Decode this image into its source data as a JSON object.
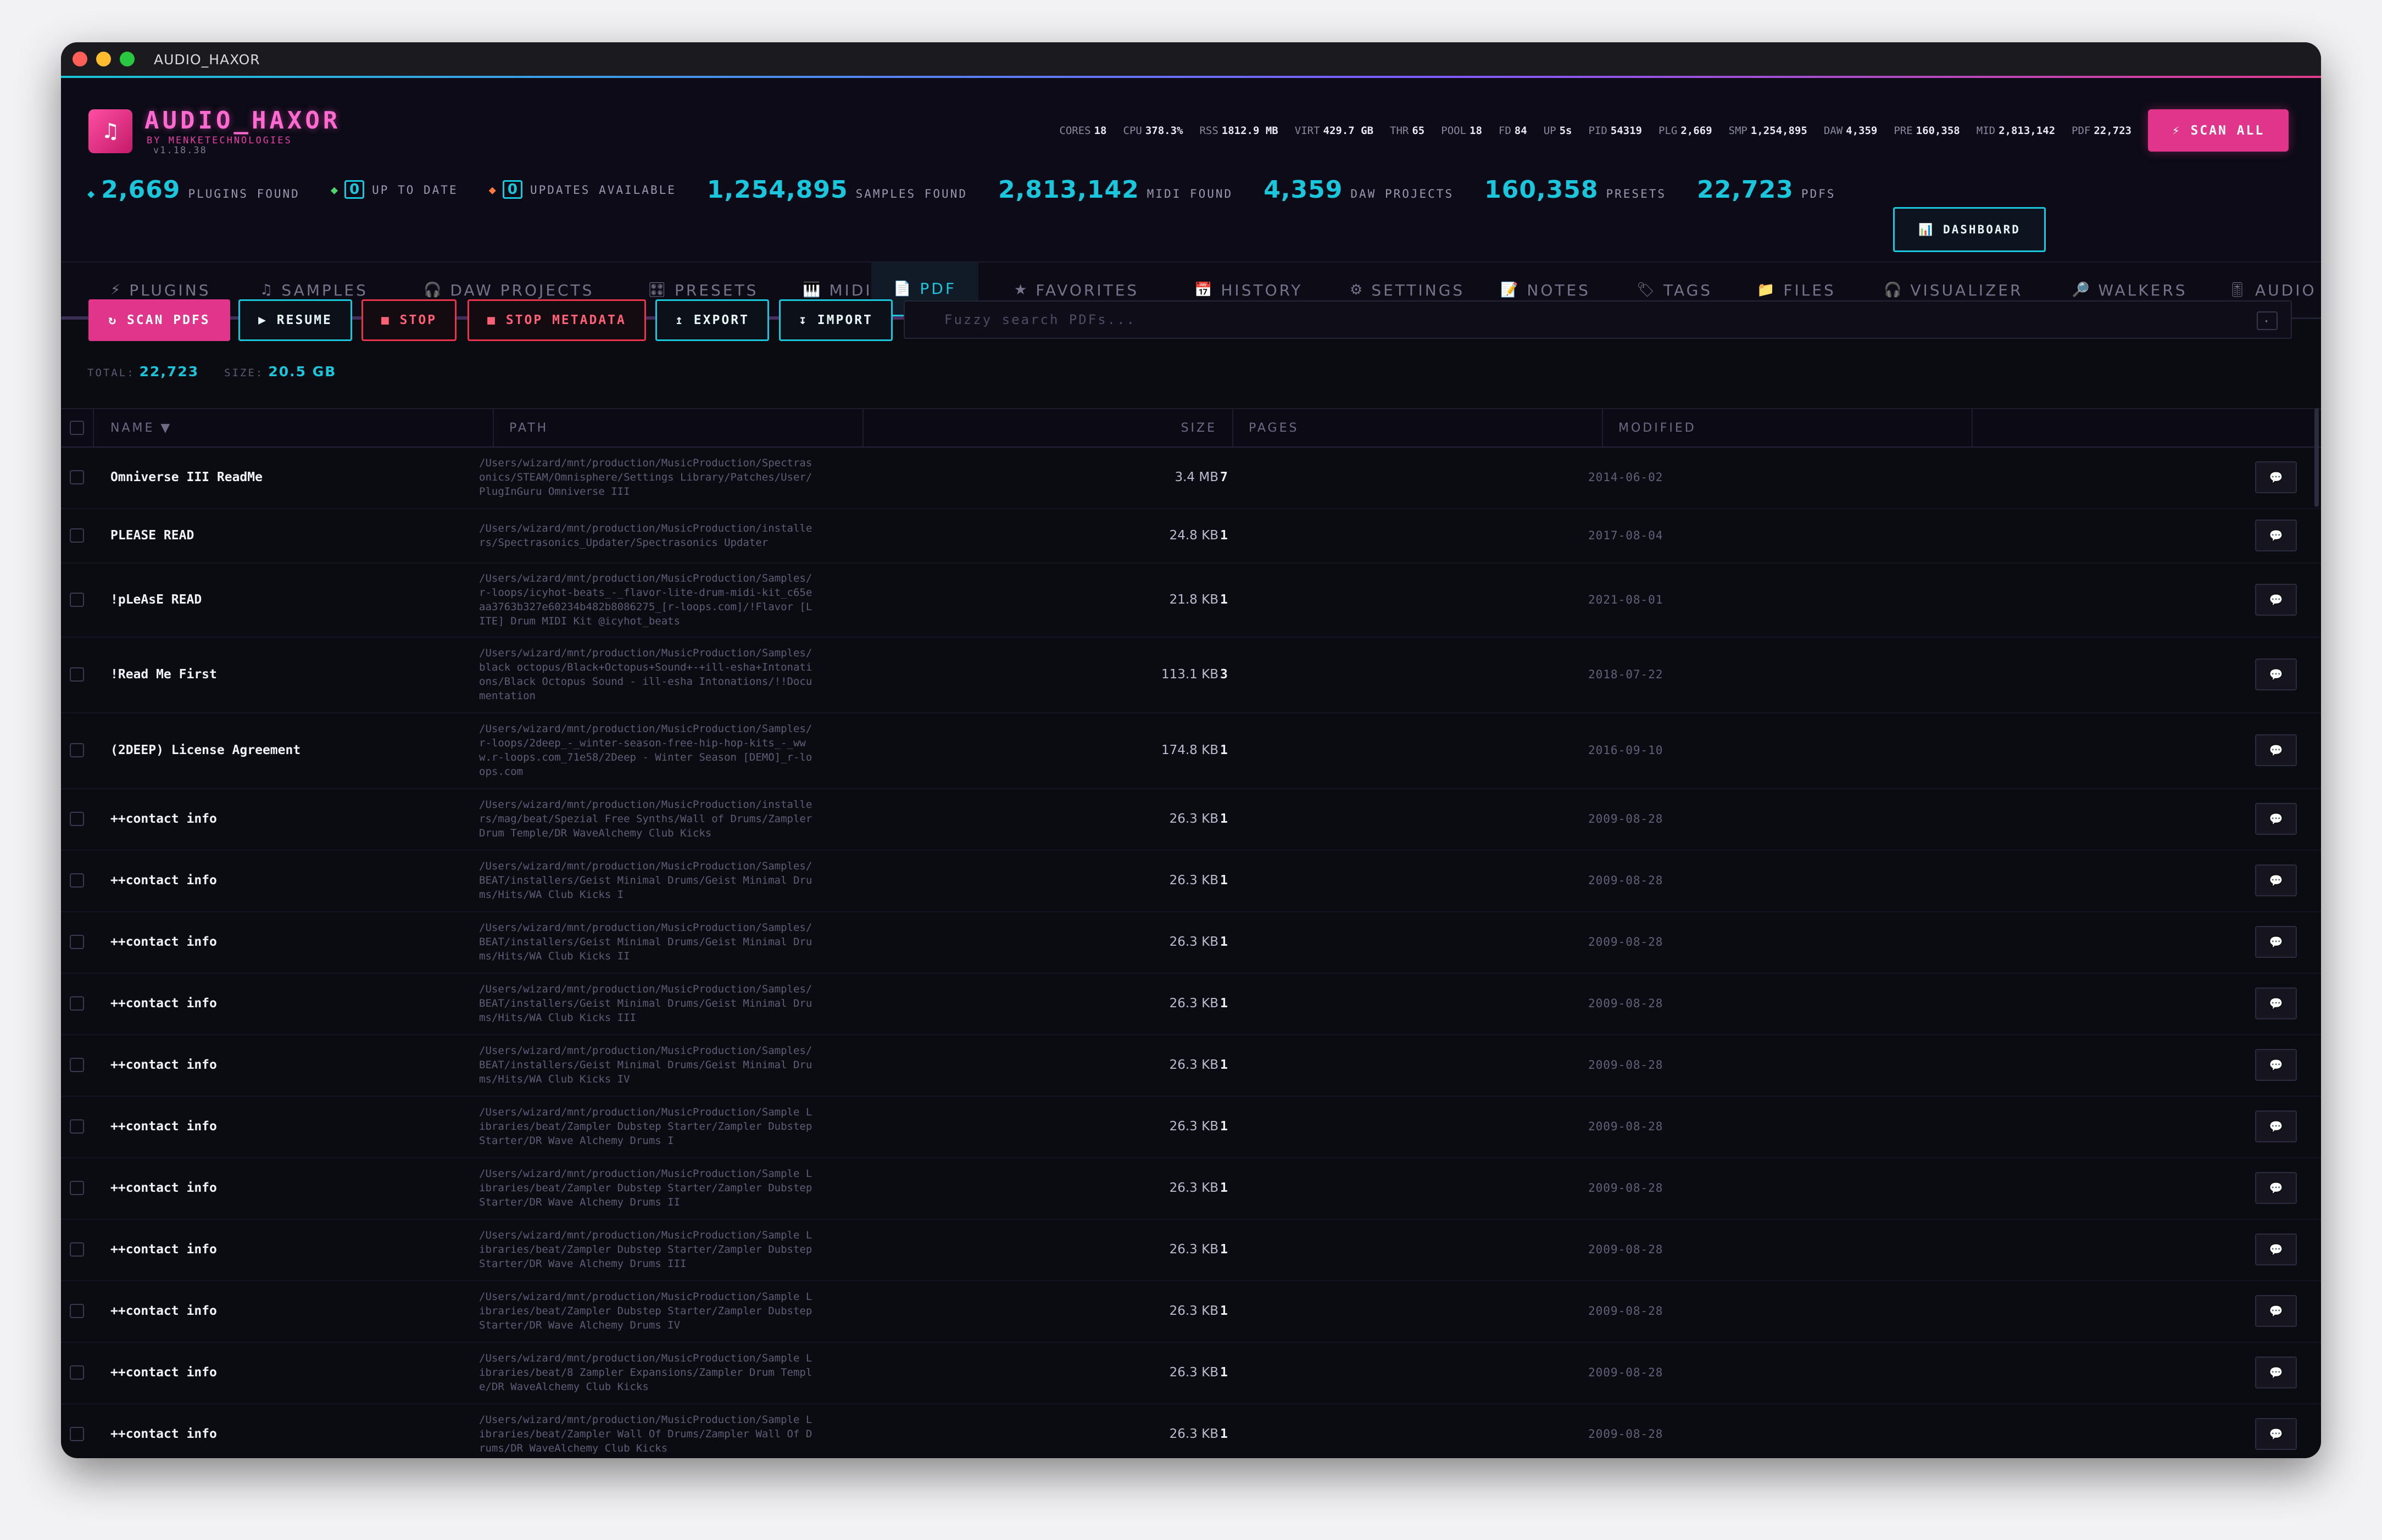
{
  "window": {
    "title": "AUDIO_HAXOR"
  },
  "app": {
    "name": "AUDIO_HAXOR",
    "by": "BY MENKETECHNOLOGIES",
    "version": "v1.18.38",
    "logo_icon": "♫"
  },
  "sys": [
    {
      "k": "CORES",
      "v": "18"
    },
    {
      "k": "CPU",
      "v": "378.3%"
    },
    {
      "k": "RSS",
      "v": "1812.9 MB"
    },
    {
      "k": "VIRT",
      "v": "429.7 GB"
    },
    {
      "k": "THR",
      "v": "65"
    },
    {
      "k": "POOL",
      "v": "18"
    },
    {
      "k": "FD",
      "v": "84"
    },
    {
      "k": "UP",
      "v": "5s"
    },
    {
      "k": "PID",
      "v": "54319"
    },
    {
      "k": "PLG",
      "v": "2,669"
    },
    {
      "k": "SMP",
      "v": "1,254,895"
    },
    {
      "k": "DAW",
      "v": "4,359"
    },
    {
      "k": "PRE",
      "v": "160,358"
    },
    {
      "k": "MID",
      "v": "2,813,142"
    },
    {
      "k": "PDF",
      "v": "22,723"
    }
  ],
  "scan_all": "⚡ SCAN ALL",
  "counters": {
    "plugins": {
      "num": "2,669",
      "label": "PLUGINS FOUND"
    },
    "uptodate": {
      "num": "0",
      "label": "UP TO DATE"
    },
    "updates": {
      "num": "0",
      "label": "UPDATES AVAILABLE"
    },
    "samples": {
      "num": "1,254,895",
      "label": "SAMPLES FOUND"
    },
    "midi": {
      "num": "2,813,142",
      "label": "MIDI FOUND"
    },
    "daw": {
      "num": "4,359",
      "label": "DAW PROJECTS"
    },
    "presets": {
      "num": "160,358",
      "label": "PRESETS"
    },
    "pdfs": {
      "num": "22,723",
      "label": "PDFS"
    }
  },
  "dashboard": "📊 DASHBOARD",
  "tabs": [
    {
      "icon": "⚡",
      "label": "PLUGINS"
    },
    {
      "icon": "♫",
      "label": "SAMPLES"
    },
    {
      "icon": "🎧",
      "label": "DAW PROJECTS"
    },
    {
      "icon": "🎛",
      "label": "PRESETS"
    },
    {
      "icon": "🎹",
      "label": "MIDI"
    },
    {
      "icon": "📄",
      "label": "PDF"
    },
    {
      "icon": "★",
      "label": "FAVORITES"
    },
    {
      "icon": "📅",
      "label": "HISTORY"
    },
    {
      "icon": "⚙",
      "label": "SETTINGS"
    },
    {
      "icon": "📝",
      "label": "NOTES"
    },
    {
      "icon": "🏷",
      "label": "TAGS"
    },
    {
      "icon": "📁",
      "label": "FILES"
    },
    {
      "icon": "🎧",
      "label": "VISUALIZER"
    },
    {
      "icon": "🔎",
      "label": "WALKERS"
    },
    {
      "icon": "🎚",
      "label": "AUDIO"
    }
  ],
  "toolbar": {
    "scan": "↻ SCAN PDFS",
    "resume": "▶ RESUME",
    "stop": "■ STOP",
    "stop_meta": "■ STOP METADATA",
    "export": "↥ EXPORT",
    "import": "↧ IMPORT",
    "search_placeholder": "Fuzzy search PDFs..."
  },
  "totals": {
    "total_label": "TOTAL:",
    "total": "22,723",
    "size_label": "SIZE:",
    "size": "20.5 GB"
  },
  "columns": {
    "name": "NAME ▼",
    "path": "PATH",
    "size": "SIZE",
    "pages": "PAGES",
    "modified": "MODIFIED"
  },
  "rows": [
    {
      "name": "Omniverse III ReadMe",
      "path": "/Users/wizard/mnt/production/MusicProduction/Spectrasonics/STEAM/Omnisphere/Settings Library/Patches/User/PlugInGuru Omniverse III",
      "size": "3.4 MB",
      "pages": "7",
      "modified": "2014-06-02"
    },
    {
      "name": "PLEASE READ",
      "path": "/Users/wizard/mnt/production/MusicProduction/installers/Spectrasonics_Updater/Spectrasonics Updater",
      "size": "24.8 KB",
      "pages": "1",
      "modified": "2017-08-04"
    },
    {
      "name": "!pLeAsE READ",
      "path": "/Users/wizard/mnt/production/MusicProduction/Samples/r-loops/icyhot-beats_-_flavor-lite-drum-midi-kit_c65eaa3763b327e60234b482b8086275_[r-loops.com]/!Flavor [LITE] Drum MIDI Kit @icyhot_beats",
      "size": "21.8 KB",
      "pages": "1",
      "modified": "2021-08-01"
    },
    {
      "name": "!Read Me First",
      "path": "/Users/wizard/mnt/production/MusicProduction/Samples/black octopus/Black+Octopus+Sound+-+ill-esha+Intonations/Black Octopus Sound - ill-esha Intonations/!!Documentation",
      "size": "113.1 KB",
      "pages": "3",
      "modified": "2018-07-22"
    },
    {
      "name": "(2DEEP) License Agreement",
      "path": "/Users/wizard/mnt/production/MusicProduction/Samples/r-loops/2deep_-_winter-season-free-hip-hop-kits_-_www.r-loops.com_71e58/2Deep - Winter Season [DEMO]_r-loops.com",
      "size": "174.8 KB",
      "pages": "1",
      "modified": "2016-09-10"
    },
    {
      "name": "++contact info",
      "path": "/Users/wizard/mnt/production/MusicProduction/installers/mag/beat/Spezial Free Synths/Wall of Drums/Zampler Drum Temple/DR WaveAlchemy Club Kicks",
      "size": "26.3 KB",
      "pages": "1",
      "modified": "2009-08-28"
    },
    {
      "name": "++contact info",
      "path": "/Users/wizard/mnt/production/MusicProduction/Samples/BEAT/installers/Geist Minimal Drums/Geist Minimal Drums/Hits/WA Club Kicks I",
      "size": "26.3 KB",
      "pages": "1",
      "modified": "2009-08-28"
    },
    {
      "name": "++contact info",
      "path": "/Users/wizard/mnt/production/MusicProduction/Samples/BEAT/installers/Geist Minimal Drums/Geist Minimal Drums/Hits/WA Club Kicks II",
      "size": "26.3 KB",
      "pages": "1",
      "modified": "2009-08-28"
    },
    {
      "name": "++contact info",
      "path": "/Users/wizard/mnt/production/MusicProduction/Samples/BEAT/installers/Geist Minimal Drums/Geist Minimal Drums/Hits/WA Club Kicks III",
      "size": "26.3 KB",
      "pages": "1",
      "modified": "2009-08-28"
    },
    {
      "name": "++contact info",
      "path": "/Users/wizard/mnt/production/MusicProduction/Samples/BEAT/installers/Geist Minimal Drums/Geist Minimal Drums/Hits/WA Club Kicks IV",
      "size": "26.3 KB",
      "pages": "1",
      "modified": "2009-08-28"
    },
    {
      "name": "++contact info",
      "path": "/Users/wizard/mnt/production/MusicProduction/Sample Libraries/beat/Zampler Dubstep Starter/Zampler Dubstep Starter/DR Wave Alchemy Drums I",
      "size": "26.3 KB",
      "pages": "1",
      "modified": "2009-08-28"
    },
    {
      "name": "++contact info",
      "path": "/Users/wizard/mnt/production/MusicProduction/Sample Libraries/beat/Zampler Dubstep Starter/Zampler Dubstep Starter/DR Wave Alchemy Drums II",
      "size": "26.3 KB",
      "pages": "1",
      "modified": "2009-08-28"
    },
    {
      "name": "++contact info",
      "path": "/Users/wizard/mnt/production/MusicProduction/Sample Libraries/beat/Zampler Dubstep Starter/Zampler Dubstep Starter/DR Wave Alchemy Drums III",
      "size": "26.3 KB",
      "pages": "1",
      "modified": "2009-08-28"
    },
    {
      "name": "++contact info",
      "path": "/Users/wizard/mnt/production/MusicProduction/Sample Libraries/beat/Zampler Dubstep Starter/Zampler Dubstep Starter/DR Wave Alchemy Drums IV",
      "size": "26.3 KB",
      "pages": "1",
      "modified": "2009-08-28"
    },
    {
      "name": "++contact info",
      "path": "/Users/wizard/mnt/production/MusicProduction/Sample Libraries/beat/8 Zampler Expansions/Zampler Drum Temple/DR WaveAlchemy Club Kicks",
      "size": "26.3 KB",
      "pages": "1",
      "modified": "2009-08-28"
    },
    {
      "name": "++contact info",
      "path": "/Users/wizard/mnt/production/MusicProduction/Sample Libraries/beat/Zampler Wall Of Drums/Zampler Wall Of Drums/DR WaveAlchemy Club Kicks",
      "size": "26.3 KB",
      "pages": "1",
      "modified": "2009-08-28"
    }
  ],
  "row_action_icon": "💬",
  "colors": {
    "accent_cyan": "#19c6dc",
    "accent_pink": "#e0358a",
    "stop_red": "#e8344a"
  }
}
